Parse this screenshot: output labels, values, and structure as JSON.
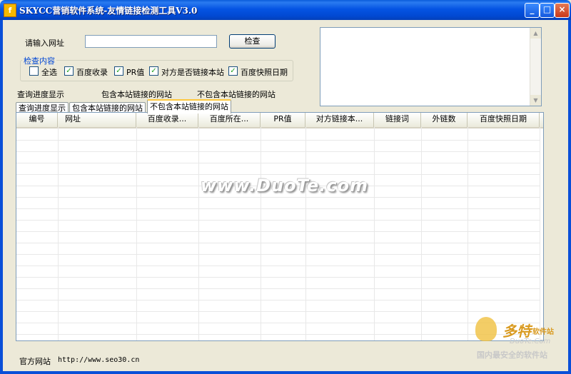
{
  "window": {
    "title": "SKYCC营销软件系统-友情链接检测工具V3.0",
    "icon_glyph": "f",
    "controls": {
      "minimize": "_",
      "maximize": "□",
      "close": "×"
    }
  },
  "form": {
    "url_label": "请输入网址",
    "url_value": "",
    "check_button": "检查"
  },
  "check_group": {
    "legend": "检查内容",
    "items": [
      {
        "label": "全选",
        "checked": false,
        "mark": ""
      },
      {
        "label": "百度收录",
        "checked": true,
        "mark": "✓"
      },
      {
        "label": "PR值",
        "checked": true,
        "mark": "✓"
      },
      {
        "label": "对方是否链接本站",
        "checked": true,
        "mark": "✓"
      },
      {
        "label": "百度快照日期",
        "checked": true,
        "mark": "✓"
      }
    ]
  },
  "status": {
    "progress_label": "查询进度显示",
    "contains_label": "包含本站链接的网站",
    "not_contains_label": "不包含本站链接的网站"
  },
  "tabs": [
    {
      "label": "查询进度显示",
      "active": false
    },
    {
      "label": "包含本站链接的网站",
      "active": false
    },
    {
      "label": "不包含本站链接的网站",
      "active": true
    }
  ],
  "table": {
    "columns": [
      "编号",
      "网址",
      "百度收录...",
      "百度所在...",
      "PR值",
      "对方链接本...",
      "链接词",
      "外链数",
      "百度快照日期"
    ],
    "rows": []
  },
  "watermark": "www.DuoTe.com",
  "footer": {
    "label": "官方网站",
    "url": "http://www.seo30.cn"
  },
  "corner_logo": {
    "big": "多特",
    "soft": "软件站",
    "en": "DuoTe.Com",
    "sub": "国内最安全的软件站"
  }
}
